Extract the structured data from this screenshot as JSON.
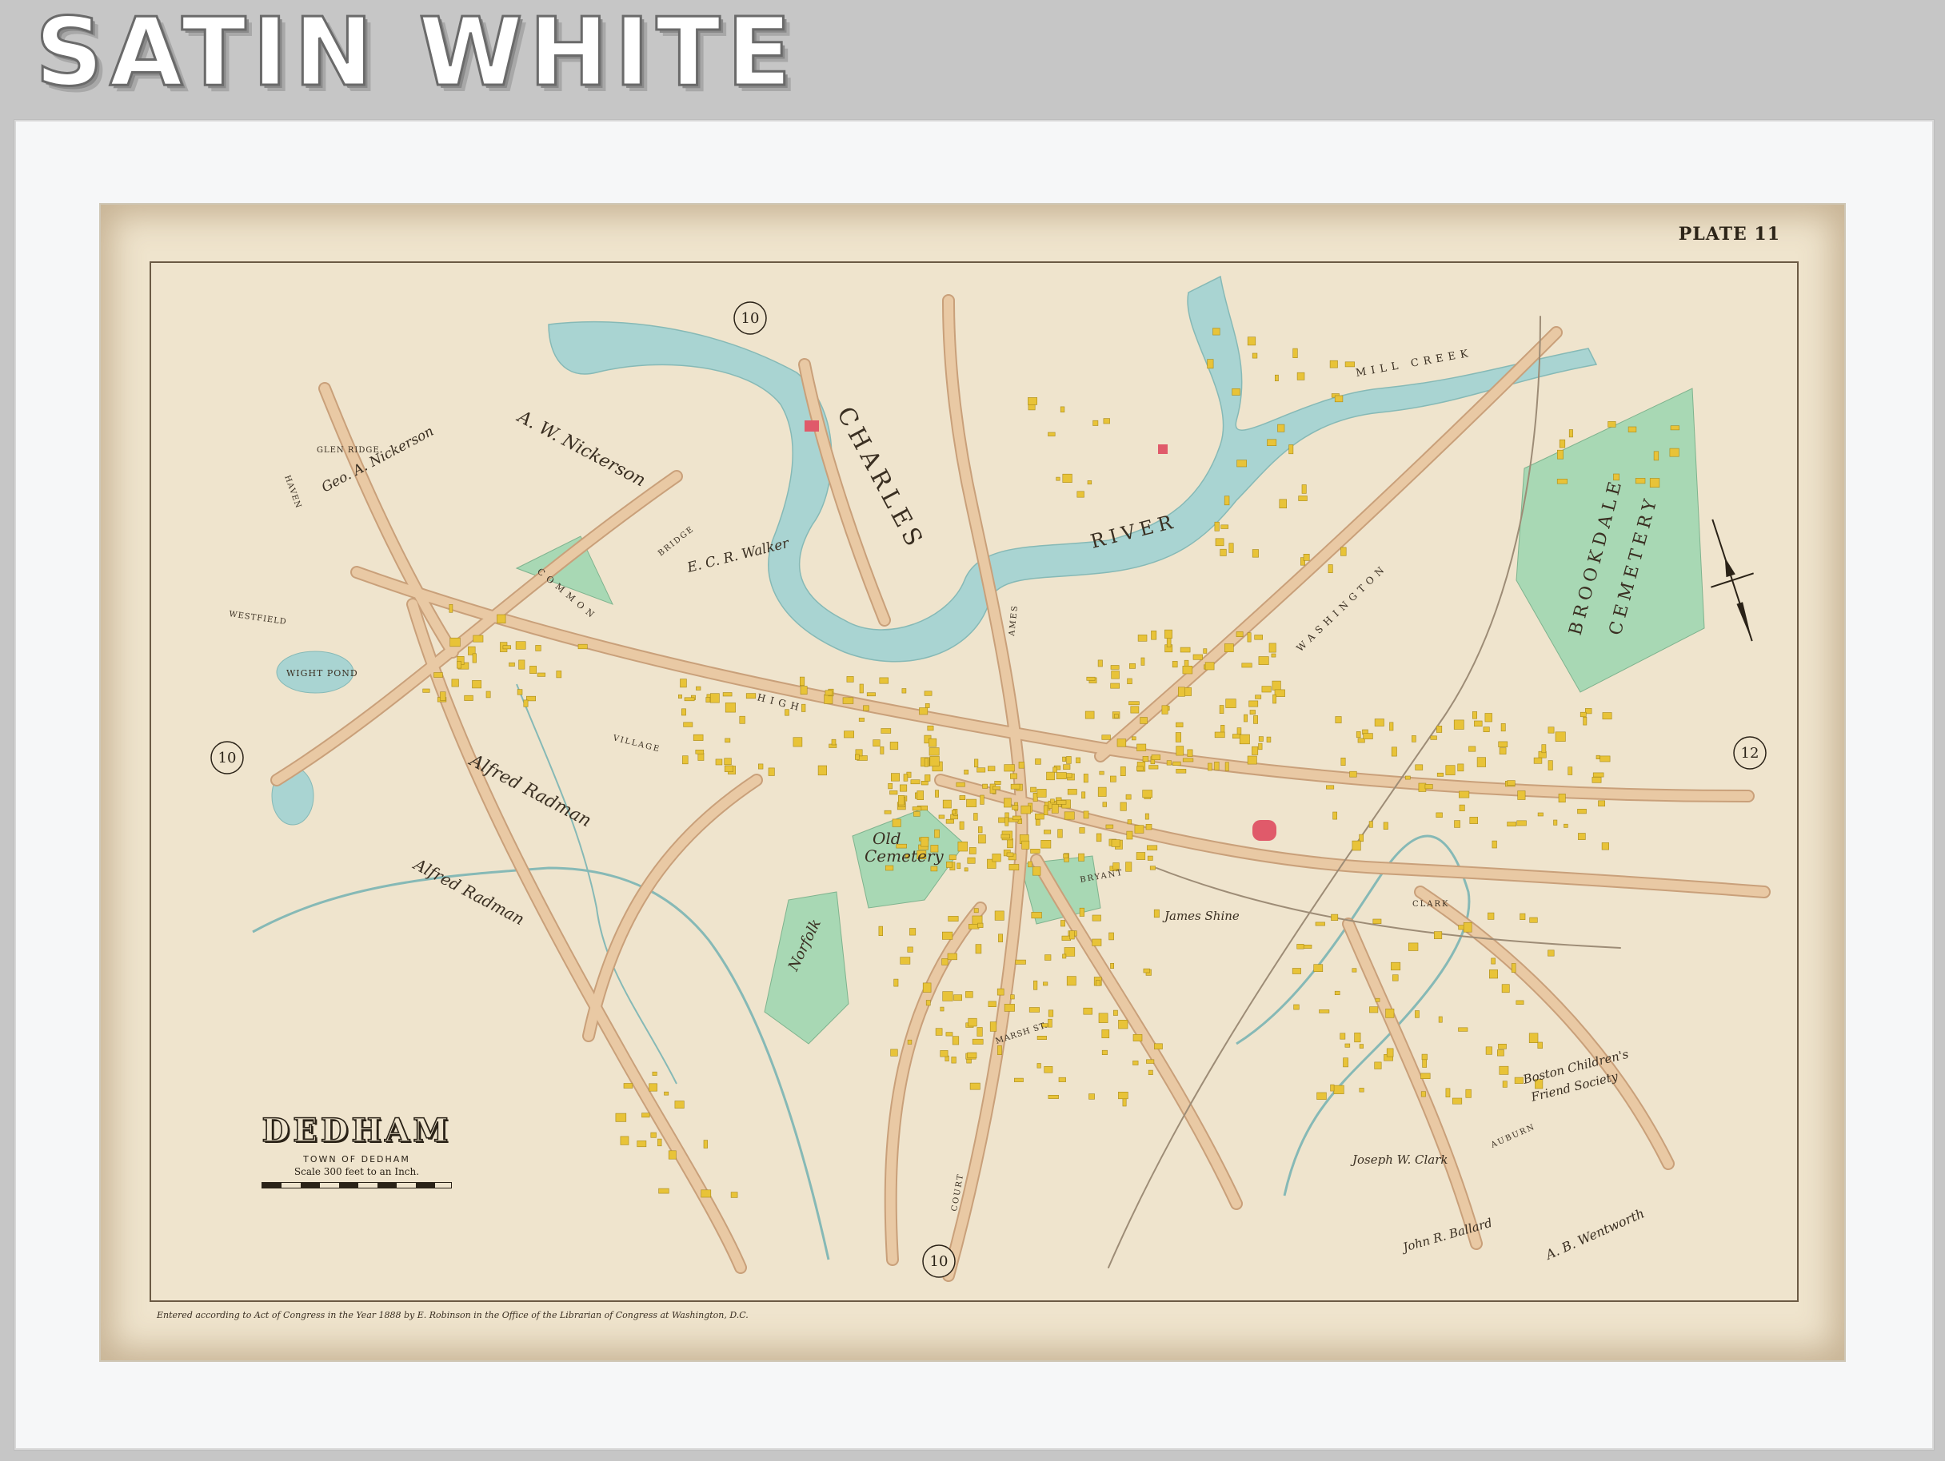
{
  "banner": {
    "text": "SATIN WHITE"
  },
  "map": {
    "plate": "PLATE 11",
    "title": "DEDHAM",
    "subtitle": "TOWN OF DEDHAM",
    "scale": "Scale 300 feet to an Inch.",
    "imprint": "Entered according to Act of Congress in the Year 1888 by E. Robinson in the Office of the Librarian of Congress at Washington, D.C.",
    "labels": {
      "charles": "CHARLES",
      "river": "RIVER",
      "brookdale": "BROOKDALE",
      "cemetery": "CEMETERY",
      "old_cemetery_1": "Old",
      "old_cemetery_2": "Cemetery",
      "wight_pond": "WIGHT POND",
      "mill_creek": "MILL CREEK",
      "high_st": "HIGH",
      "washington_st": "WASHINGTON",
      "common": "COMMON",
      "glen_ridge": "GLEN RIDGE",
      "nickerson": "A. W. Nickerson",
      "alfred_radman_1": "Alfred Radman",
      "alfred_radman_2": "Alfred Radman",
      "geo_nickerson": "Geo. A. Nickerson",
      "james_shine": "James Shine",
      "joseph_clark": "Joseph W. Clark",
      "boston_childrens": "Boston Children's",
      "aid_society": "Friend Society",
      "norfolk": "Norfolk",
      "ecr_walker": "E. C. R. Walker",
      "ab_wentworth": "A. B. Wentworth",
      "john_ballard": "John R. Ballard",
      "village": "VILLAGE",
      "bryant": "BRYANT",
      "marsh_st": "MARSH ST.",
      "court": "COURT",
      "auburn": "AUBURN",
      "clark": "CLARK",
      "ames": "AMES",
      "westfield": "WESTFIELD",
      "haven": "HAVEN",
      "bridge": "BRIDGE"
    },
    "routes": [
      "10",
      "10",
      "10",
      "10",
      "12"
    ],
    "colors": {
      "paper": "#efe4cd",
      "road": "#e9c9a4",
      "road_edge": "#c9a07a",
      "water": "#a9d4d2",
      "park": "#a8d8b4",
      "building": "#e8c338",
      "building_red": "#e05a6a"
    }
  }
}
